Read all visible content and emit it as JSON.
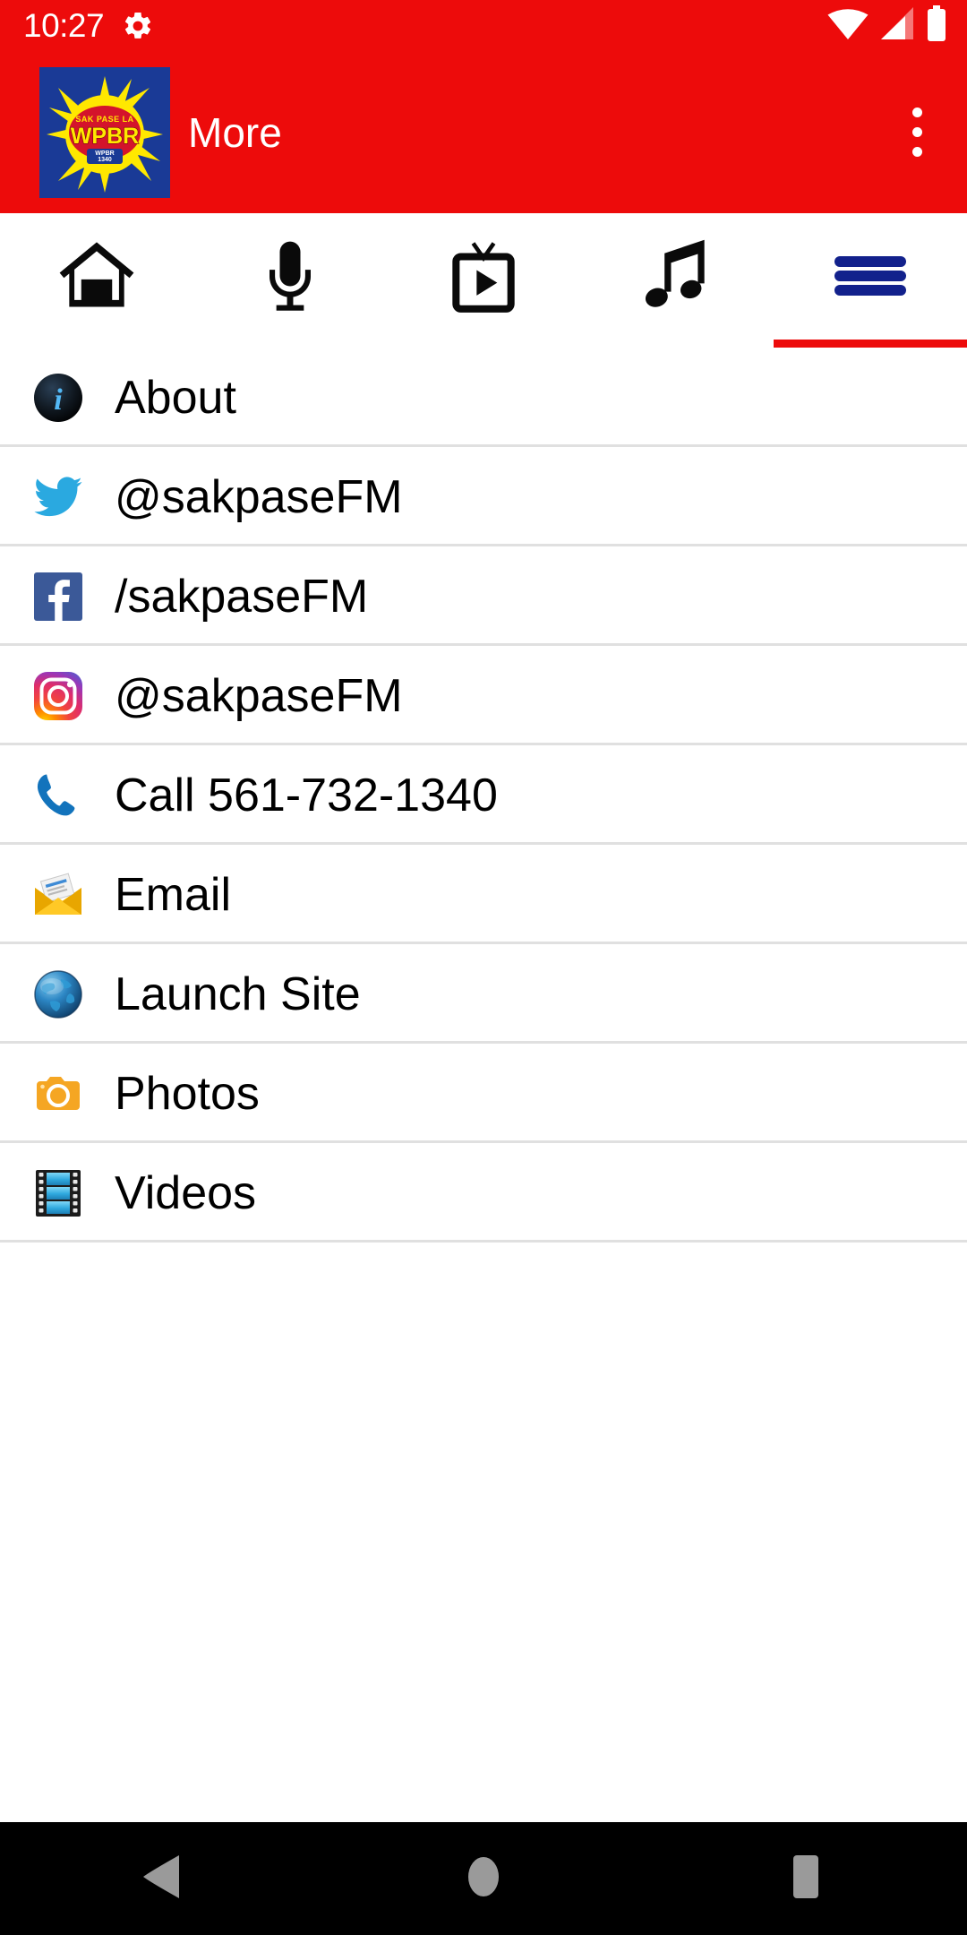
{
  "status_bar": {
    "time": "10:27",
    "gear_icon": "gear-icon",
    "wifi_icon": "wifi-icon",
    "signal_icon": "cell-signal-icon",
    "battery_icon": "battery-full-icon"
  },
  "app_bar": {
    "title": "More",
    "logo_alt": "WPBR sakpase radio station logo",
    "logo_text_main": "WPBR",
    "logo_text_top": "SAK PASE LA",
    "logo_text_bottom": "WPBR 1340",
    "overflow_icon": "overflow-menu-icon",
    "background_color": "#ED0B0B"
  },
  "tabs": {
    "active_index": 4,
    "indicator_color": "#ED0B0B",
    "items": [
      {
        "name": "tab-home",
        "icon": "home-icon",
        "label": "Home",
        "active": false
      },
      {
        "name": "tab-podcast",
        "icon": "microphone-icon",
        "label": "Podcast",
        "active": false
      },
      {
        "name": "tab-video",
        "icon": "tv-play-icon",
        "label": "Video",
        "active": false
      },
      {
        "name": "tab-music",
        "icon": "music-note-icon",
        "label": "Music",
        "active": false
      },
      {
        "name": "tab-more",
        "icon": "hamburger-menu-icon",
        "label": "More",
        "active": true
      }
    ]
  },
  "menu": {
    "items": [
      {
        "name": "list-item-about",
        "icon": "info-circle-icon",
        "label": "About"
      },
      {
        "name": "list-item-twitter",
        "icon": "twitter-bird-icon",
        "label": "@sakpaseFM"
      },
      {
        "name": "list-item-facebook",
        "icon": "facebook-f-icon",
        "label": "/sakpaseFM"
      },
      {
        "name": "list-item-instagram",
        "icon": "instagram-icon",
        "label": "@sakpaseFM"
      },
      {
        "name": "list-item-call",
        "icon": "phone-icon",
        "label": "Call 561-732-1340"
      },
      {
        "name": "list-item-email",
        "icon": "envelope-icon",
        "label": "Email"
      },
      {
        "name": "list-item-launch-site",
        "icon": "globe-icon",
        "label": "Launch Site"
      },
      {
        "name": "list-item-photos",
        "icon": "camera-icon",
        "label": "Photos"
      },
      {
        "name": "list-item-videos",
        "icon": "film-strip-icon",
        "label": "Videos"
      }
    ]
  },
  "nav_bar": {
    "back_icon": "back-triangle-icon",
    "home_icon": "home-circle-icon",
    "recents_icon": "recents-square-icon",
    "background_color": "#000000"
  }
}
